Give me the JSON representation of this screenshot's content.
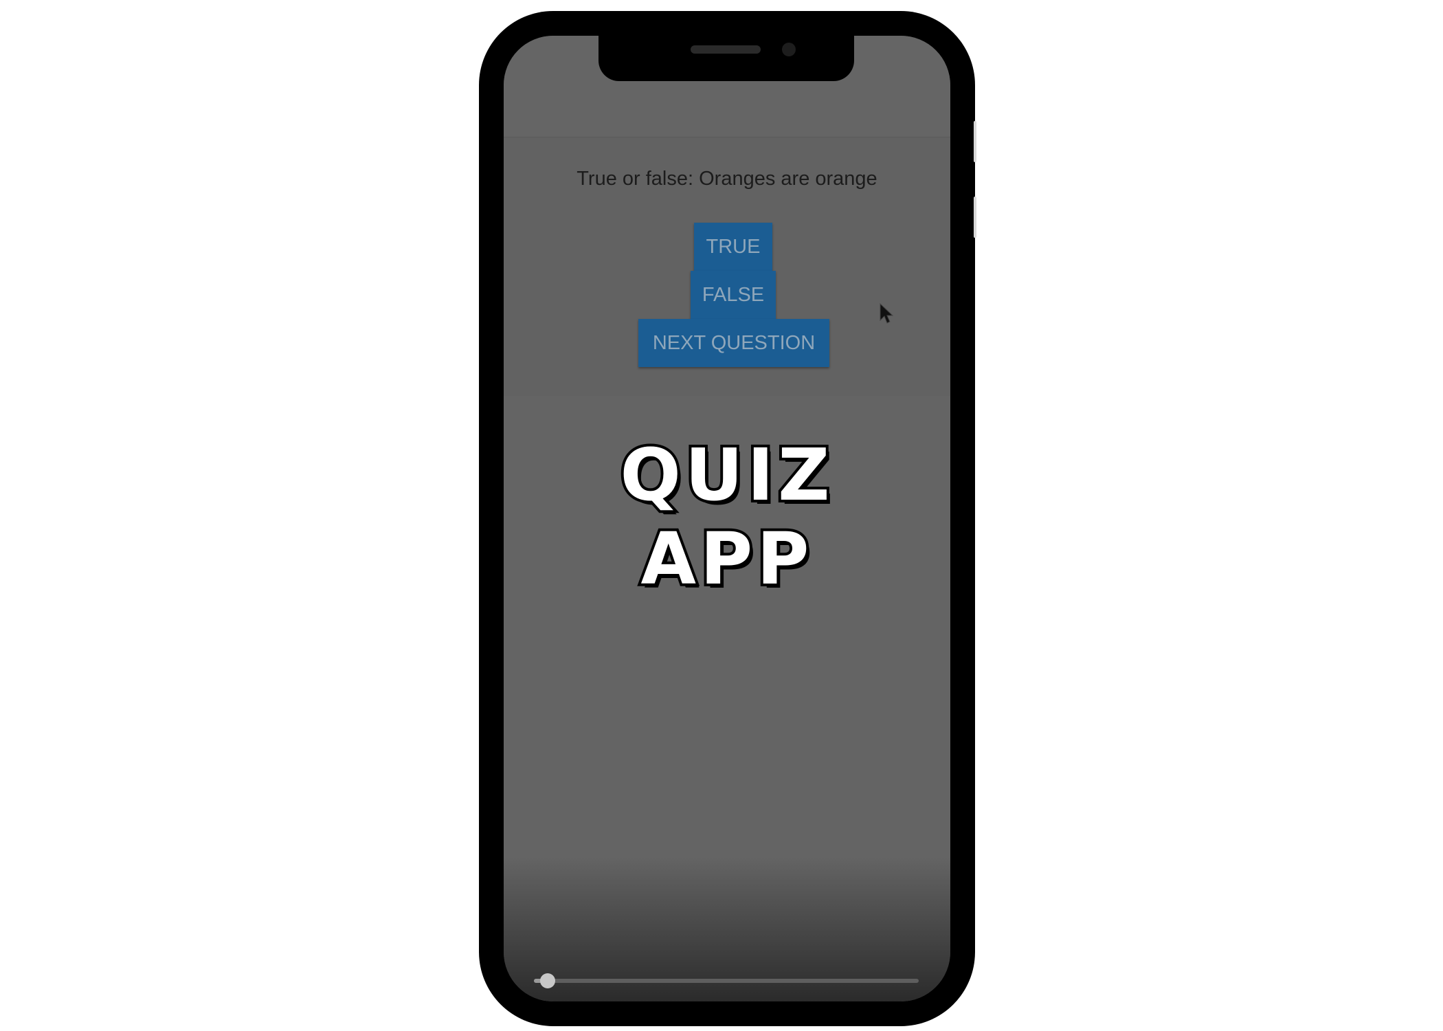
{
  "quiz": {
    "question": "True or false: Oranges are orange",
    "true_label": "TRUE",
    "false_label": "FALSE",
    "next_label": "NEXT QUESTION"
  },
  "overlay": {
    "line1": "QUIZ",
    "line2": "APP"
  },
  "video": {
    "progress_fraction": 0.035
  },
  "colors": {
    "button_bg": "#1b5d93",
    "screen_bg": "#646464"
  },
  "icons": [
    "mouse-cursor-icon"
  ]
}
